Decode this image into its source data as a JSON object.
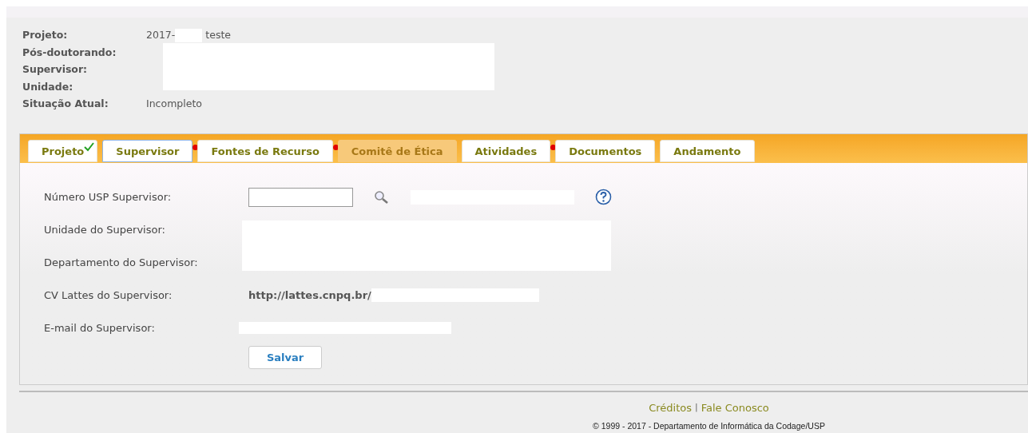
{
  "project_info": [
    {
      "label": "Projeto:",
      "value": "2017-",
      "value_after": "teste"
    },
    {
      "label": "Pós-doutorando:"
    },
    {
      "label": "Supervisor:"
    },
    {
      "label": "Unidade:"
    },
    {
      "label": "Situação Atual:",
      "value": "Incompleto"
    }
  ],
  "tabs": [
    {
      "label": "Projeto",
      "selected": false,
      "disabled": false,
      "complete": true,
      "pending": false
    },
    {
      "label": "Supervisor",
      "selected": true,
      "disabled": false,
      "complete": false,
      "pending": true
    },
    {
      "label": "Fontes de Recurso",
      "selected": false,
      "disabled": false,
      "complete": false,
      "pending": true
    },
    {
      "label": "Comitê de Ética",
      "selected": false,
      "disabled": true,
      "complete": false,
      "pending": false
    },
    {
      "label": "Atividades",
      "selected": false,
      "disabled": false,
      "complete": false,
      "pending": true
    },
    {
      "label": "Documentos",
      "selected": false,
      "disabled": false,
      "complete": false,
      "pending": false
    },
    {
      "label": "Andamento",
      "selected": false,
      "disabled": false,
      "complete": false,
      "pending": false
    }
  ],
  "form": {
    "fields": [
      {
        "label": "Número USP Supervisor:",
        "kind": "lookup"
      },
      {
        "label": "Unidade do Supervisor:",
        "kind": "block"
      },
      {
        "label": "Departamento do Supervisor:",
        "kind": "block"
      },
      {
        "label": "CV Lattes do Supervisor:",
        "kind": "link",
        "value": "http://lattes.cnpq.br/"
      },
      {
        "label": "E-mail do Supervisor:",
        "kind": "email"
      }
    ],
    "save_button": "Salvar"
  },
  "footer": {
    "links": [
      "Créditos",
      "Fale Conosco"
    ],
    "separator": "|",
    "copyright": "© 1999 - 2017 - Departamento de Informática da Codage/USP"
  }
}
